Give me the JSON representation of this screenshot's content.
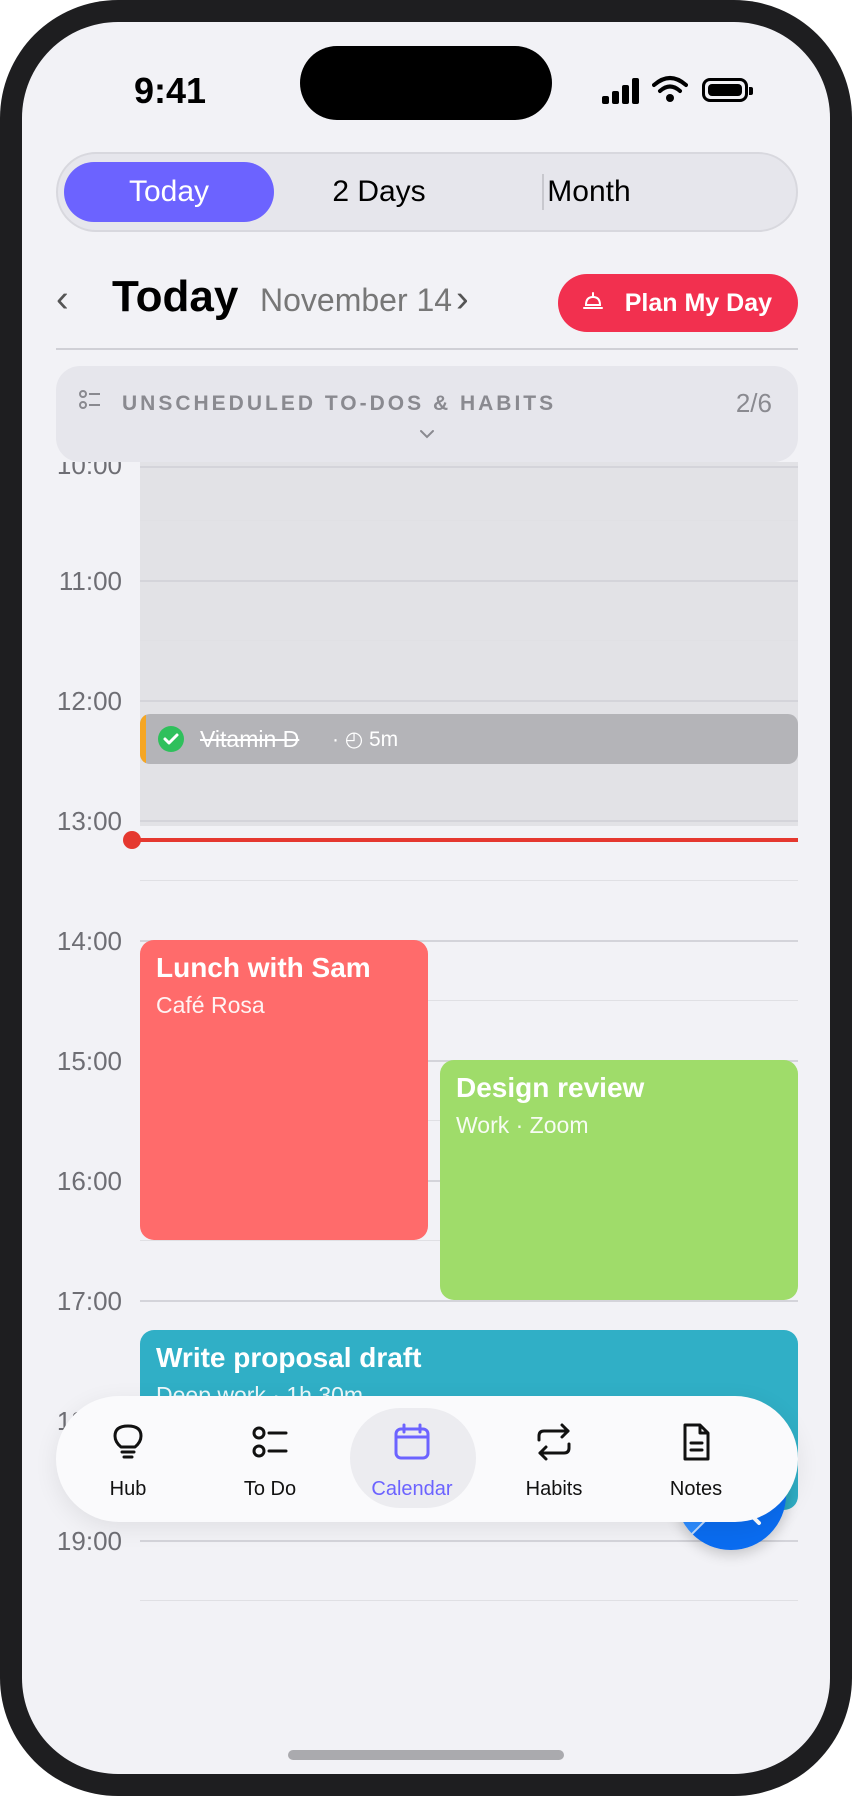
{
  "status_bar": {
    "time": "9:41"
  },
  "view_switcher": {
    "items": [
      "Today",
      "2 Days",
      "Month"
    ],
    "active": "Today"
  },
  "day_header": {
    "title": "Today",
    "date": "November 14",
    "prev": "‹",
    "next": "›"
  },
  "plan_button": {
    "label": "Plan My Day"
  },
  "unscheduled": {
    "label": "UNSCHEDULED TO-DOS & HABITS",
    "count": "2/6"
  },
  "timeline": {
    "hours": [
      "10:00",
      "11:00",
      "12:00",
      "13:00",
      "14:00",
      "15:00",
      "16:00",
      "17:00",
      "18:00",
      "19:00"
    ],
    "current_time": "13:09"
  },
  "habit": {
    "name": "Vitamin D",
    "meta": "· ◴ 5m",
    "accent": "#f5a623"
  },
  "events": [
    {
      "title": "Lunch with Sam",
      "subtitle": "Café Rosa",
      "color": "#ff6b6b",
      "start": "14:00",
      "end": "16:30"
    },
    {
      "title": "Design review",
      "subtitle": "Work · Zoom",
      "color": "#9fdc6a",
      "start": "15:00",
      "end": "17:00"
    },
    {
      "title": "Write proposal draft",
      "subtitle": "Deep work · 1h 30m",
      "color": "#30afc6",
      "start": "17:15",
      "end": "18:45"
    }
  ],
  "fab": {
    "icons": [
      "plus-icon",
      "search-icon"
    ]
  },
  "tabs": [
    {
      "label": "Hub",
      "icon": "lightbulb-icon"
    },
    {
      "label": "To Do",
      "icon": "checklist-icon"
    },
    {
      "label": "Calendar",
      "icon": "calendar-icon",
      "active": true
    },
    {
      "label": "Habits",
      "icon": "repeat-icon"
    },
    {
      "label": "Notes",
      "icon": "document-icon"
    }
  ],
  "colors": {
    "accent": "#6c63ff",
    "plan_button": "#f2304f",
    "now_line": "#e5382f"
  }
}
